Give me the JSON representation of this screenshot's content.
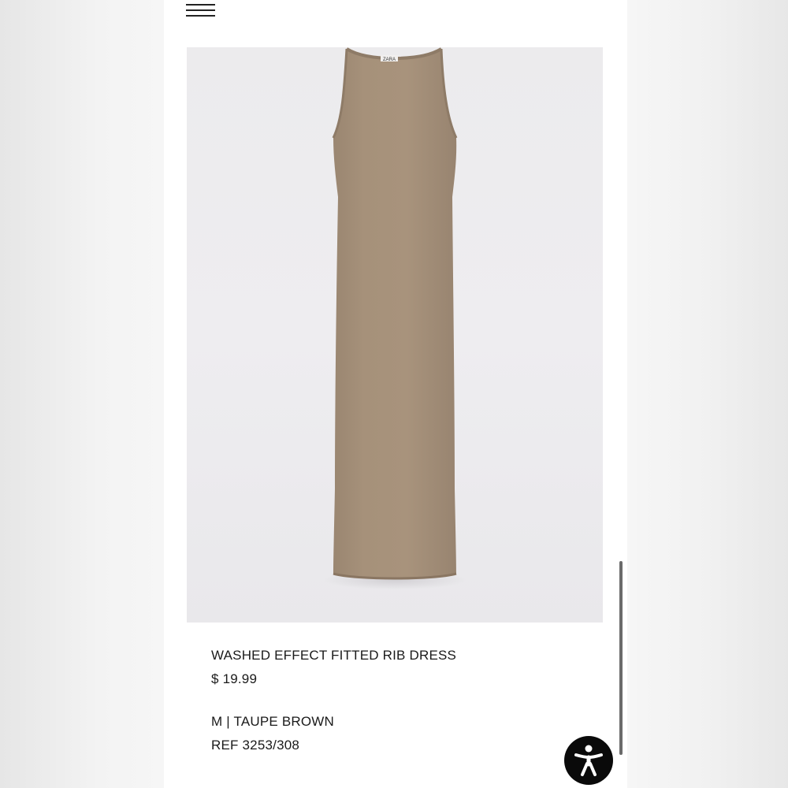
{
  "nav": {
    "menu_icon": "hamburger-menu-icon"
  },
  "product": {
    "image_subject": "dress",
    "brand_tag": "ZARA",
    "name": "WASHED EFFECT FITTED RIB DRESS",
    "price": "$ 19.99",
    "variant": "M | TAUPE BROWN",
    "reference": "REF 3253/308",
    "colors": {
      "garment": "#a48f78",
      "background": "#ecebed"
    }
  },
  "accessibility": {
    "icon": "accessibility-person-icon"
  }
}
